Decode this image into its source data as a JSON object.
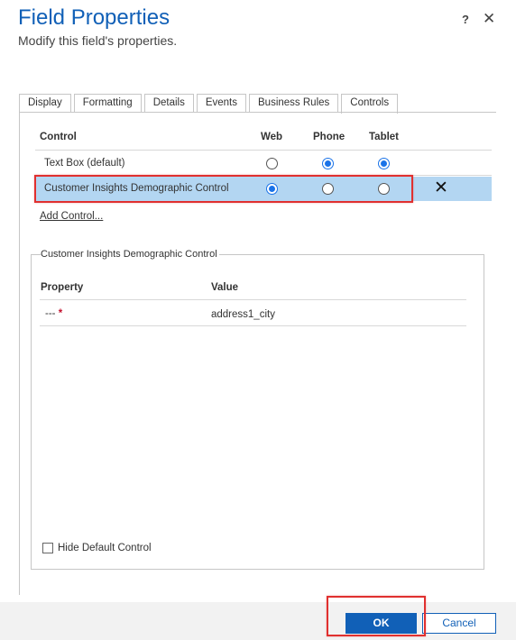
{
  "dialog": {
    "title": "Field Properties",
    "subtitle": "Modify this field's properties.",
    "help_label": "?",
    "close_label": "✕"
  },
  "tabs": [
    {
      "label": "Display"
    },
    {
      "label": "Formatting"
    },
    {
      "label": "Details"
    },
    {
      "label": "Events"
    },
    {
      "label": "Business Rules"
    },
    {
      "label": "Controls",
      "active": true
    }
  ],
  "controls_table": {
    "headers": {
      "control": "Control",
      "web": "Web",
      "phone": "Phone",
      "tablet": "Tablet"
    },
    "rows": [
      {
        "name": "Text Box (default)",
        "web": false,
        "phone": true,
        "tablet": true
      },
      {
        "name": "Customer Insights Demographic Control",
        "web": true,
        "phone": false,
        "tablet": false,
        "selected": true
      }
    ],
    "remove_label": "✕",
    "add_link": "Add Control..."
  },
  "control_properties": {
    "legend": "Customer Insights Demographic Control",
    "headers": {
      "property": "Property",
      "value": "Value"
    },
    "rows": [
      {
        "property": "---",
        "required_marker": "*",
        "value": "address1_city"
      }
    ],
    "hide_default_label": "Hide Default Control",
    "hide_default_checked": false
  },
  "footer": {
    "ok_label": "OK",
    "cancel_label": "Cancel"
  },
  "colors": {
    "accent": "#1160b7",
    "selection": "#b3d6f2",
    "highlight_box": "#e0302f",
    "radio_checked": "#1a73e8"
  }
}
